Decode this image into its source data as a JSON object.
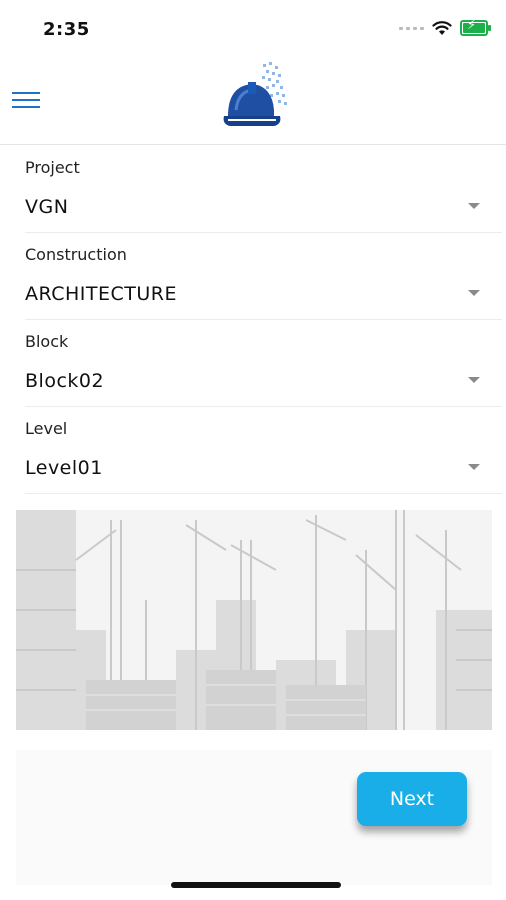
{
  "status_bar": {
    "time": "2:35",
    "battery_color": "#1db04a"
  },
  "header": {
    "menu_icon": "hamburger-menu-icon",
    "logo_icon": "hard-hat-logo-icon"
  },
  "form": {
    "fields": [
      {
        "label": "Project",
        "value": "VGN"
      },
      {
        "label": "Construction",
        "value": "ARCHITECTURE"
      },
      {
        "label": "Block",
        "value": "Block02"
      },
      {
        "label": "Level",
        "value": "Level01"
      }
    ]
  },
  "illustration": {
    "icon": "construction-cranes-skyline-image"
  },
  "actions": {
    "next_label": "Next",
    "next_color": "#19aee8"
  },
  "colors": {
    "accent": "#1e73c8"
  }
}
